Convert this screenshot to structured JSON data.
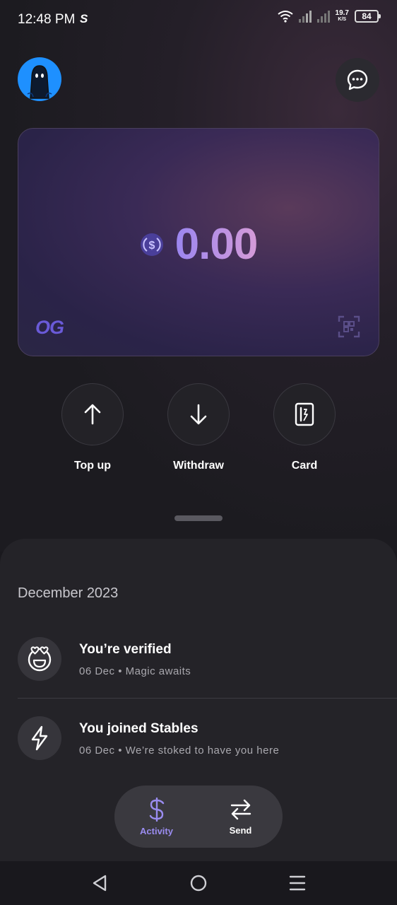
{
  "status_bar": {
    "time": "12:48 PM",
    "speed_value": "19.7",
    "speed_unit": "K/S",
    "battery": "84"
  },
  "header": {
    "avatar_icon": "ghost-avatar",
    "chat_icon": "chat-bubble-icon"
  },
  "balance_card": {
    "currency_icon": "usdc-icon",
    "amount": "0.00",
    "logo": "OG",
    "scan_icon": "scan-icon"
  },
  "actions": [
    {
      "label": "Top up",
      "icon": "arrow-up-icon"
    },
    {
      "label": "Withdraw",
      "icon": "arrow-down-icon"
    },
    {
      "label": "Card",
      "icon": "card-icon"
    }
  ],
  "activity": {
    "month": "December 2023",
    "items": [
      {
        "title": "You’re verified",
        "subtitle": "06 Dec • Magic awaits",
        "icon": "heart-eyes-face-icon"
      },
      {
        "title": "You joined Stables",
        "subtitle": "06 Dec • We’re stoked to have you here",
        "icon": "lightning-icon"
      }
    ]
  },
  "tabbar": {
    "tabs": [
      {
        "label": "Activity",
        "icon": "dollar-icon",
        "active": true
      },
      {
        "label": "Send",
        "icon": "transfer-arrows-icon",
        "active": false
      }
    ],
    "active_color": "#9a8cf0"
  },
  "navbar": {
    "buttons": [
      "back-icon",
      "home-icon",
      "menu-icon"
    ]
  }
}
